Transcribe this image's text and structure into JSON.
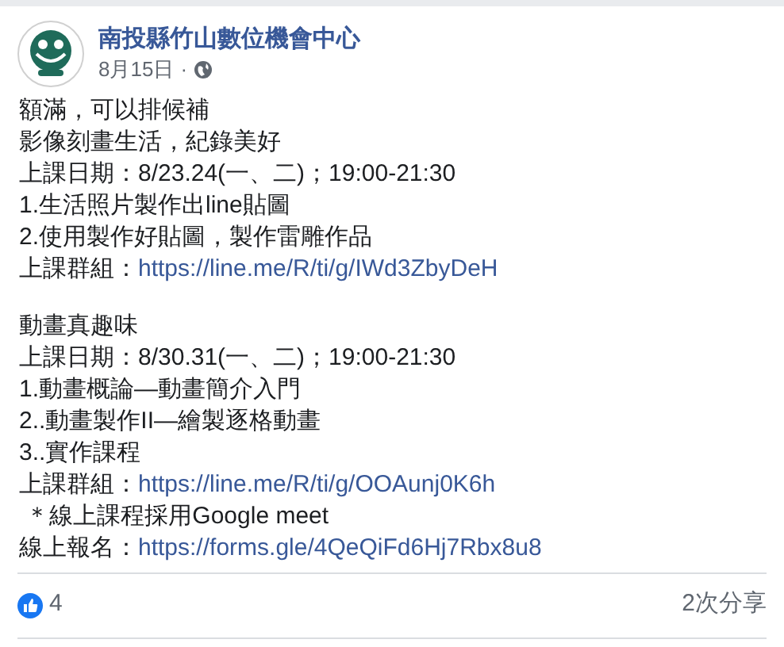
{
  "post": {
    "author": "南投縣竹山數位機會中心",
    "date": "8月15日",
    "separator": "·",
    "paragraphs": [
      [
        {
          "text": "額滿，可以排候補"
        },
        {
          "text": "影像刻畫生活，紀錄美好"
        },
        {
          "text": "上課日期：8/23.24(一、二)；19:00-21:30"
        },
        {
          "text": "1.生活照片製作出line貼圖"
        },
        {
          "text": "2.使用製作好貼圖，製作雷雕作品"
        },
        {
          "text": "上課群組：",
          "link": "https://line.me/R/ti/g/IWd3ZbyDeH"
        }
      ],
      [
        {
          "text": "動畫真趣味"
        },
        {
          "text": "上課日期：8/30.31(一、二)；19:00-21:30"
        },
        {
          "text": "1.動畫概論—動畫簡介入門"
        },
        {
          "text": "2..動畫製作II—繪製逐格動畫"
        },
        {
          "text": "3..實作課程"
        },
        {
          "text": "上課群組：",
          "link": "https://line.me/R/ti/g/OOAunj0K6h"
        },
        {
          "text": " ＊線上課程採用Google meet"
        },
        {
          "text": "線上報名：",
          "link": "https://forms.gle/4QeQiFd6Hj7Rbx8u8"
        }
      ]
    ],
    "likes": "4",
    "shares": "2次分享"
  }
}
